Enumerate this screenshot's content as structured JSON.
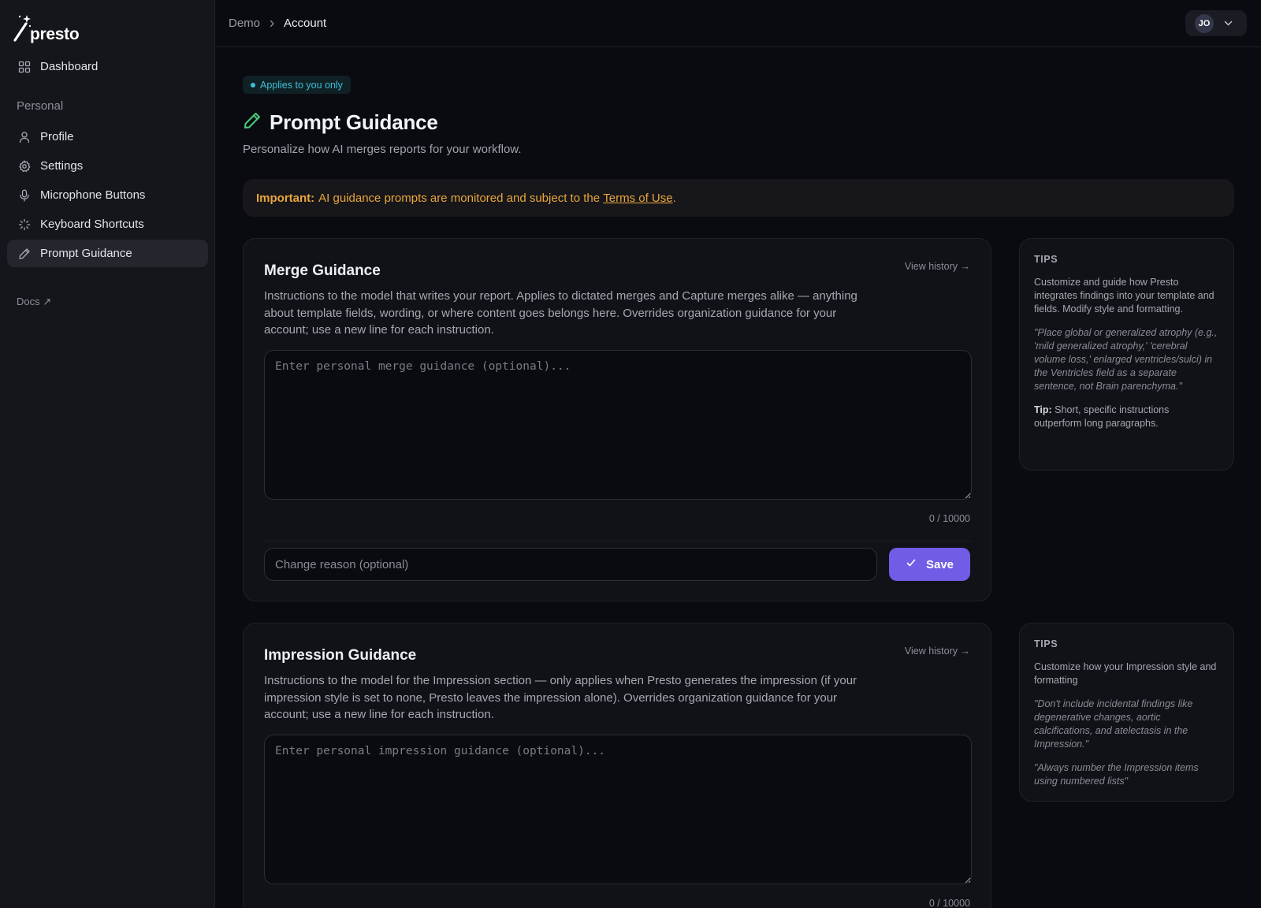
{
  "app": {
    "name": "presto"
  },
  "sidebar": {
    "dashboard": "Dashboard",
    "section_label": "Personal",
    "items": [
      {
        "label": "Profile",
        "icon": "user-icon"
      },
      {
        "label": "Settings",
        "icon": "gear-icon"
      },
      {
        "label": "Microphone Buttons",
        "icon": "microphone-icon"
      },
      {
        "label": "Keyboard Shortcuts",
        "icon": "loader-icon"
      },
      {
        "label": "Prompt Guidance",
        "icon": "pencil-icon",
        "active": true
      }
    ],
    "docs": "Docs ↗"
  },
  "topbar": {
    "breadcrumb": [
      "Demo",
      "Account"
    ],
    "user_initials": "JO"
  },
  "page": {
    "badge": "Applies to you only",
    "title": "Prompt Guidance",
    "subtitle": "Personalize how AI merges reports for your workflow."
  },
  "alert": {
    "bold": "Important:",
    "text": "AI guidance prompts are monitored and subject to the",
    "link": "Terms of Use",
    "suffix": "."
  },
  "merge": {
    "title": "Merge Guidance",
    "history": "View history →",
    "description": "Instructions to the model that writes your report. Applies to dictated merges and Capture merges alike — anything about template fields, wording, or where content goes belongs here. Overrides organization guidance for your account; use a new line for each instruction.",
    "placeholder": "Enter personal merge guidance (optional)...",
    "value": "",
    "counter": "0 / 10000",
    "reason_placeholder": "Change reason (optional)",
    "save_label": "Save"
  },
  "merge_tips": {
    "label": "TIPS",
    "body": "Customize and guide how Presto integrates findings into your template and fields. Modify style and formatting.",
    "quote": "\"Place global or generalized atrophy (e.g., 'mild generalized atrophy,' 'cerebral volume loss,' enlarged ventricles/sulci) in the Ventricles field as a separate sentence, not Brain parenchyma.\"",
    "tip_bold": "Tip:",
    "tip_text": "Short, specific instructions outperform long paragraphs."
  },
  "impression": {
    "title": "Impression Guidance",
    "history": "View history →",
    "description": "Instructions to the model for the Impression section — only applies when Presto generates the impression (if your impression style is set to none, Presto leaves the impression alone). Overrides organization guidance for your account; use a new line for each instruction.",
    "placeholder": "Enter personal impression guidance (optional)...",
    "value": "",
    "counter": "0 / 10000"
  },
  "impression_tips": {
    "label": "TIPS",
    "body": "Customize how your Impression style and formatting",
    "quote1": "\"Don't include incidental findings like degenerative changes, aortic calcifications, and atelectasis in the Impression.\"",
    "quote2": "\"Always number the Impression items using numbered lists\""
  },
  "colors": {
    "accent": "#6f5de6",
    "badge": "#3ebfd6",
    "warning": "#e8a73a",
    "pencil": "#4cc97a"
  }
}
